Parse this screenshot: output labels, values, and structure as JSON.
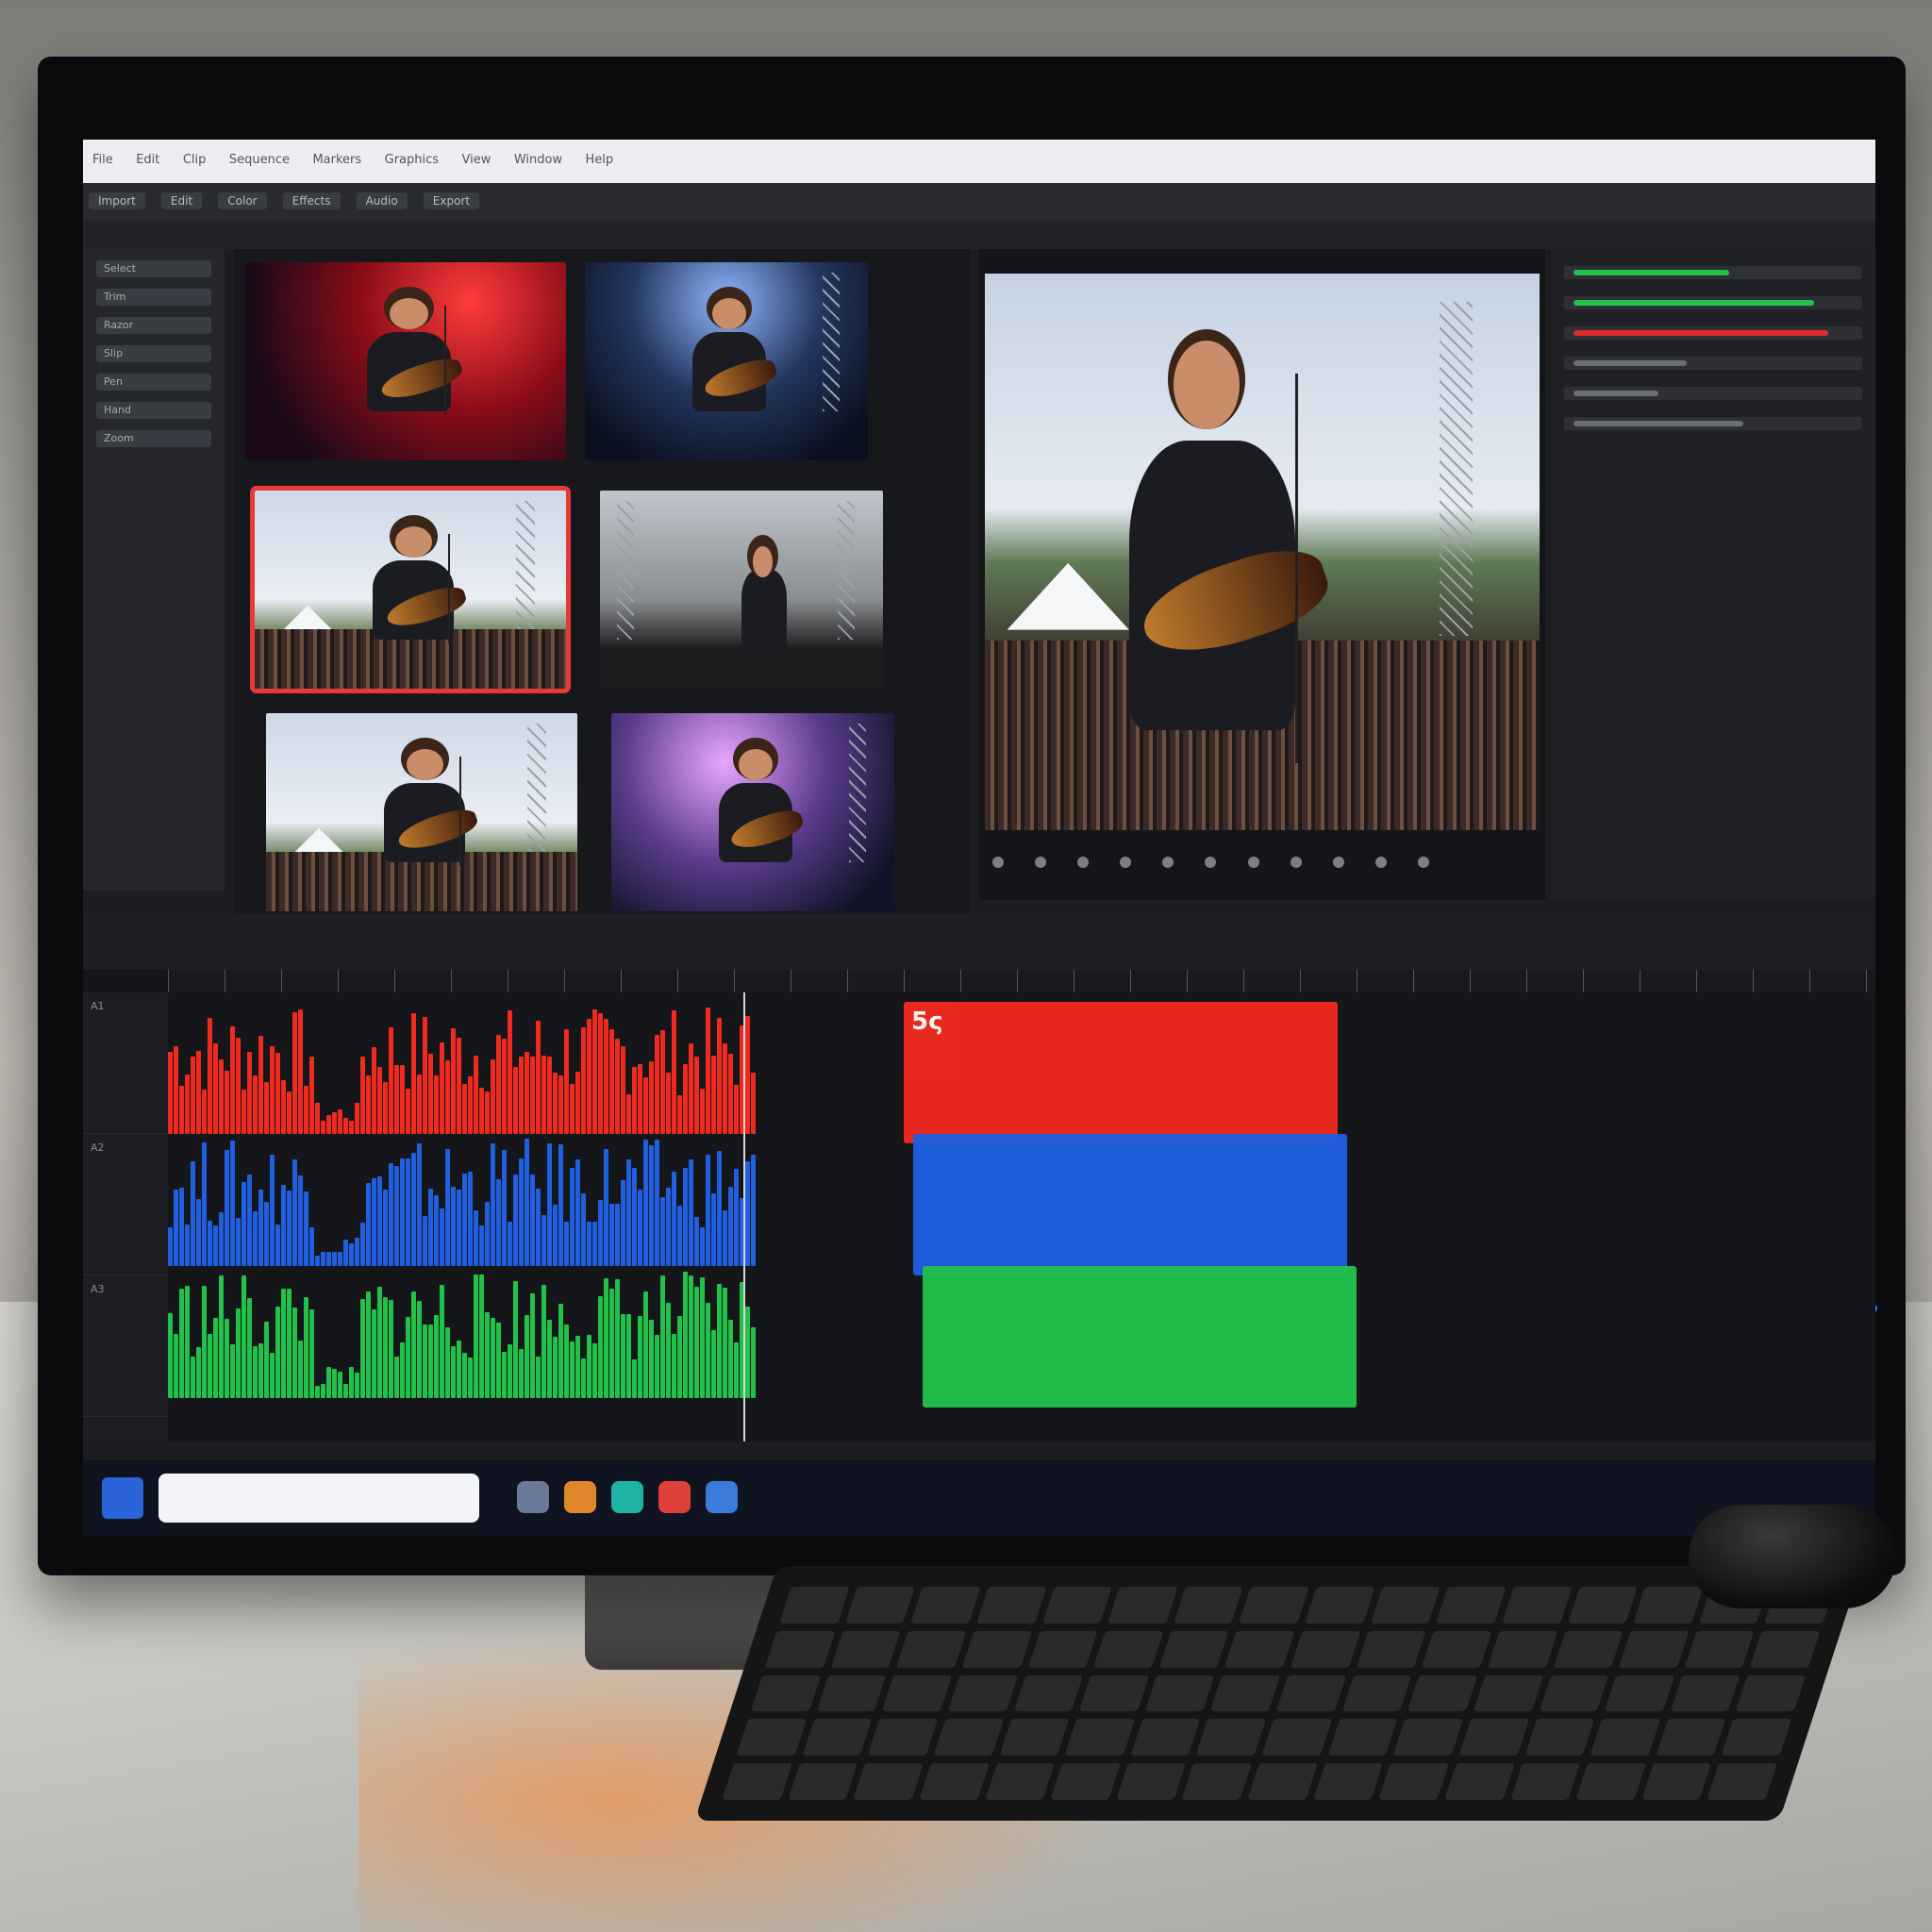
{
  "app": {
    "title": "",
    "menu": [
      "File",
      "Edit",
      "Clip",
      "Sequence",
      "Markers",
      "Graphics",
      "View",
      "Window",
      "Help"
    ],
    "toolbar": [
      "Import",
      "Edit",
      "Color",
      "Effects",
      "Audio",
      "Export"
    ],
    "panel_labels": {
      "media": "",
      "preview": ""
    }
  },
  "tools": [
    "Select",
    "Trim",
    "Razor",
    "Slip",
    "Pen",
    "Hand",
    "Zoom"
  ],
  "media": {
    "thumbnails": [
      {
        "scene": "night-red",
        "selected": false
      },
      {
        "scene": "night-blue",
        "selected": false
      },
      {
        "scene": "day",
        "selected": true
      },
      {
        "scene": "day-stage",
        "selected": false
      },
      {
        "scene": "day",
        "selected": false
      },
      {
        "scene": "night-purple",
        "selected": false
      }
    ]
  },
  "preview": {
    "scene": "day-closeup"
  },
  "inspector": {
    "rows": [
      {
        "color": "#22c24a",
        "level": 0.55
      },
      {
        "color": "#22c24a",
        "level": 0.85
      },
      {
        "color": "#e02c2c",
        "level": 0.9
      },
      {
        "color": "#6b6e76",
        "level": 0.4
      },
      {
        "color": "#6b6e76",
        "level": 0.3
      },
      {
        "color": "#6b6e76",
        "level": 0.6
      }
    ]
  },
  "timeline": {
    "tracks": [
      {
        "name": "A1",
        "color": "#f02a1f"
      },
      {
        "name": "A2",
        "color": "#1f5fe0"
      },
      {
        "name": "A3",
        "color": "#22c24a"
      }
    ],
    "clips": [
      {
        "track": 0,
        "color": "#f02a1f",
        "title": "5ς"
      },
      {
        "track": 1,
        "color": "#1f5fe0",
        "title": ""
      },
      {
        "track": 2,
        "color": "#22c24a",
        "title": ""
      }
    ]
  },
  "taskbar": {
    "search_placeholder": "",
    "icons": [
      {
        "name": "folder-icon",
        "color": "#6b7a99"
      },
      {
        "name": "files-icon",
        "color": "#e0862b"
      },
      {
        "name": "browser-icon",
        "color": "#1fb3a3"
      },
      {
        "name": "record-icon",
        "color": "#e0403a"
      },
      {
        "name": "settings-icon",
        "color": "#3a7bdc"
      }
    ]
  },
  "colors": {
    "selection": "#e63b35",
    "accent": "#2b64d8"
  }
}
